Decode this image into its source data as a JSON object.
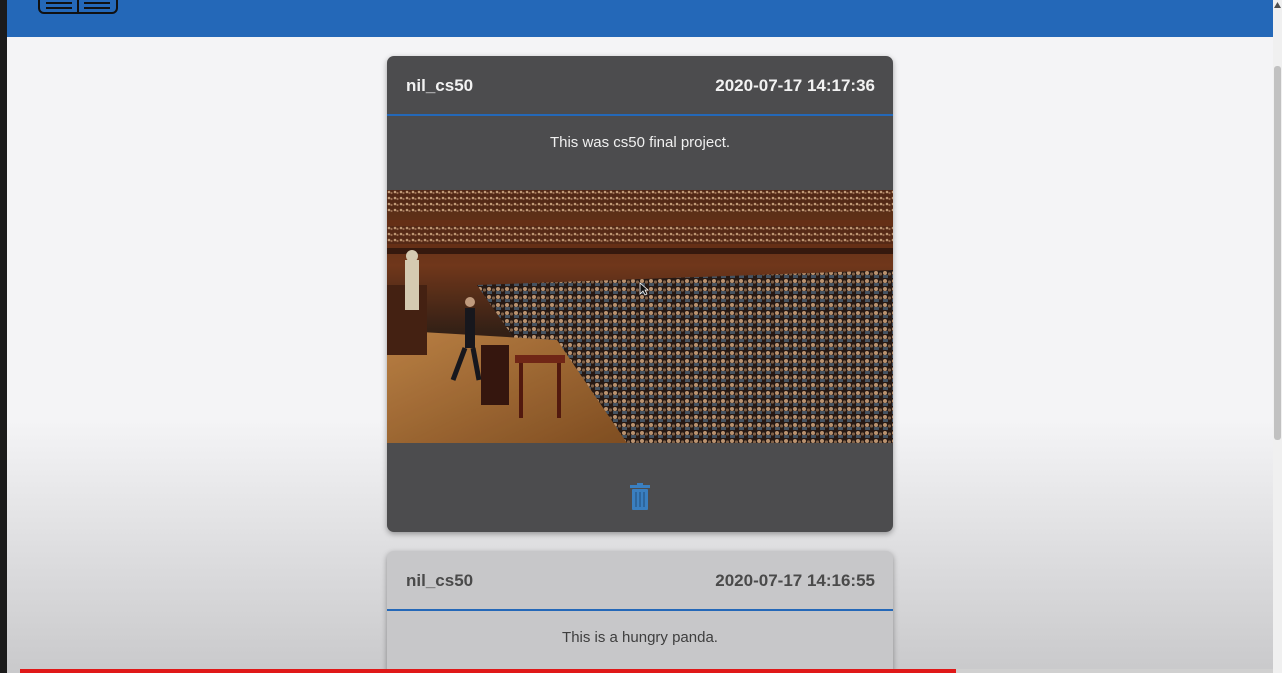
{
  "navbar": {
    "color": "#2468b8",
    "logo_icon": "book-logo-icon"
  },
  "posts": [
    {
      "username": "nil_cs50",
      "timestamp": "2020-07-17 14:17:36",
      "text": "This was cs50 final project.",
      "image": "lecture-hall-photo",
      "delete_icon": "trash-icon",
      "theme": "dark"
    },
    {
      "username": "nil_cs50",
      "timestamp": "2020-07-17 14:16:55",
      "text": "This is a hungry panda.",
      "theme": "light"
    }
  ],
  "video_player": {
    "progress": 0.747,
    "progress_color": "#e01818"
  },
  "scrollbar": {
    "up_icon": "scroll-up-arrow-icon"
  }
}
